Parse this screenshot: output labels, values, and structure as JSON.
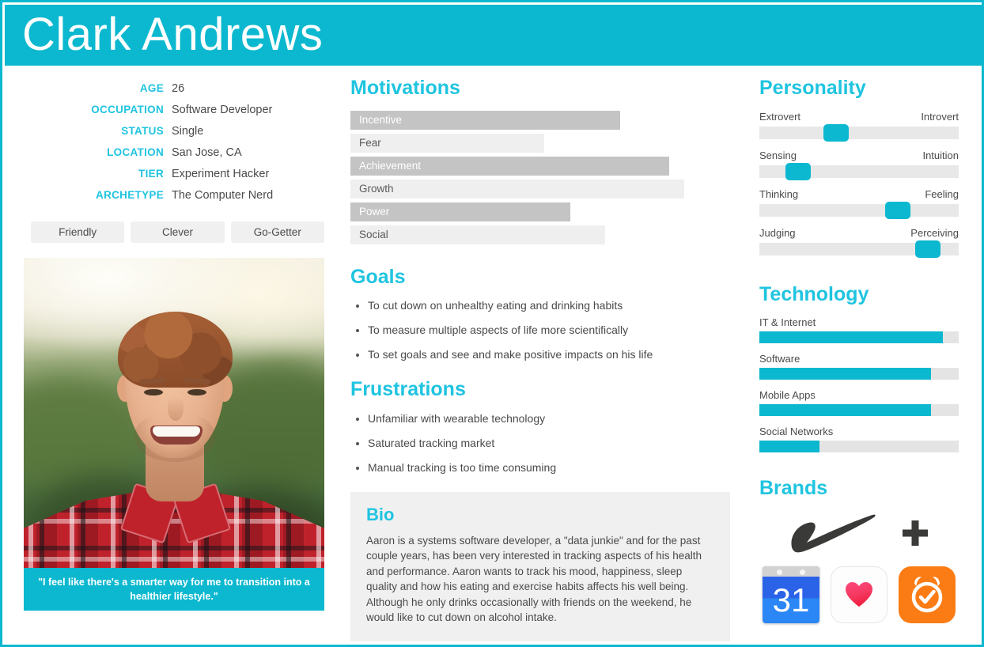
{
  "header": {
    "name": "Clark Andrews",
    "accent_color": "#0bb8cf"
  },
  "profile": {
    "attributes": [
      {
        "label": "AGE",
        "value": "26"
      },
      {
        "label": "OCCUPATION",
        "value": "Software Developer"
      },
      {
        "label": "STATUS",
        "value": "Single"
      },
      {
        "label": "LOCATION",
        "value": "San Jose, CA"
      },
      {
        "label": "TIER",
        "value": "Experiment Hacker"
      },
      {
        "label": "ARCHETYPE",
        "value": "The Computer Nerd"
      }
    ],
    "tags": [
      "Friendly",
      "Clever",
      "Go-Getter"
    ],
    "quote": "\"I feel like there's a smarter way for me to transition into a healthier lifestyle.\""
  },
  "motivations": {
    "title": "Motivations",
    "chart_data": {
      "type": "bar",
      "title": "Motivations",
      "categories": [
        "Incentive",
        "Fear",
        "Achievement",
        "Growth",
        "Power",
        "Social"
      ],
      "values": [
        71,
        51,
        84,
        88,
        58,
        67
      ],
      "xlabel": "",
      "ylabel": "",
      "xlim": [
        0,
        100
      ],
      "grid": false,
      "styles": [
        "dark",
        "light",
        "dark",
        "light",
        "dark",
        "light"
      ]
    }
  },
  "goals": {
    "title": "Goals",
    "items": [
      "To cut down on unhealthy eating and drinking habits",
      "To measure multiple aspects of life more scientifically",
      "To set goals and see and make positive impacts on his life"
    ]
  },
  "frustrations": {
    "title": "Frustrations",
    "items": [
      "Unfamiliar with wearable technology",
      "Saturated tracking market",
      "Manual tracking is too time consuming"
    ]
  },
  "bio": {
    "title": "Bio",
    "text": "Aaron is a systems software developer, a \"data junkie\" and for the past couple years, has been very interested in tracking aspects of his health and performance. Aaron wants to track his mood, happiness, sleep quality and how his eating and exercise habits affects his well being. Although he only drinks occasionally with friends on the weekend, he would like to cut down on alcohol intake."
  },
  "personality": {
    "title": "Personality",
    "chart_data": {
      "type": "bar",
      "title": "Personality",
      "categories": [
        "Extrovert / Introvert",
        "Sensing / Intuition",
        "Thinking / Feeling",
        "Judging / Perceiving"
      ],
      "values": [
        36,
        16,
        67,
        82
      ],
      "xlim": [
        0,
        100
      ],
      "grid": false
    },
    "scales": [
      {
        "left": "Extrovert",
        "right": "Introvert",
        "position": 36
      },
      {
        "left": "Sensing",
        "right": "Intuition",
        "position": 16
      },
      {
        "left": "Thinking",
        "right": "Feeling",
        "position": 67
      },
      {
        "left": "Judging",
        "right": "Perceiving",
        "position": 82
      }
    ]
  },
  "technology": {
    "title": "Technology",
    "chart_data": {
      "type": "bar",
      "title": "Technology",
      "categories": [
        "IT & Internet",
        "Software",
        "Mobile Apps",
        "Social Networks"
      ],
      "values": [
        92,
        86,
        86,
        30
      ],
      "xlim": [
        0,
        100
      ],
      "grid": false
    },
    "items": [
      {
        "label": "IT & Internet",
        "value": 92
      },
      {
        "label": "Software",
        "value": 86
      },
      {
        "label": "Mobile Apps",
        "value": 86
      },
      {
        "label": "Social Networks",
        "value": 30
      }
    ]
  },
  "brands": {
    "title": "Brands",
    "items": [
      {
        "name": "nike-plus-logo",
        "label": "Nike+"
      },
      {
        "name": "google-calendar-icon",
        "label": "31"
      },
      {
        "name": "apple-health-icon",
        "label": "Health"
      },
      {
        "name": "alarm-clock-icon",
        "label": "Alarm"
      }
    ]
  }
}
